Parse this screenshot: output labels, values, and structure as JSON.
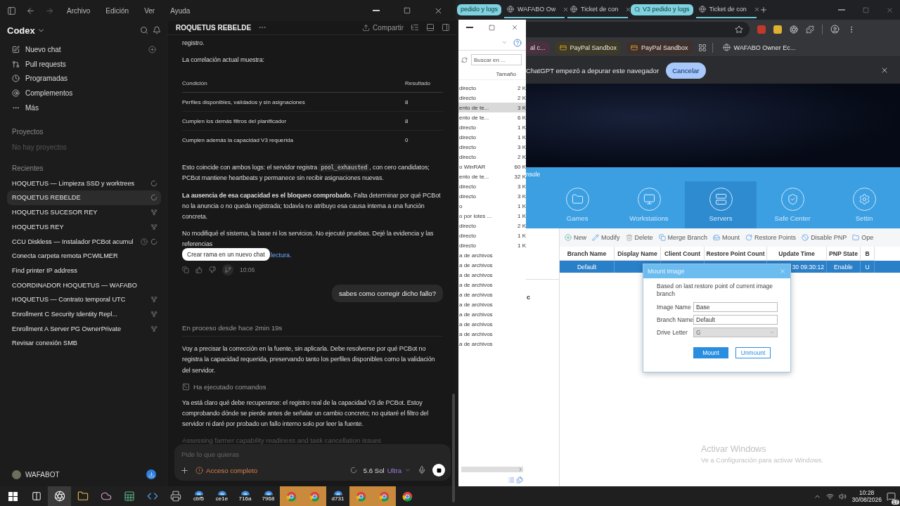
{
  "codex": {
    "menu": [
      "Archivo",
      "Edición",
      "Ver",
      "Ayuda"
    ],
    "app_name": "Codex",
    "nav": [
      {
        "kind": "new",
        "label": "Nuevo chat"
      },
      {
        "kind": "pulls",
        "label": "Pull requests"
      },
      {
        "kind": "scheduled",
        "label": "Programadas"
      },
      {
        "kind": "plugins",
        "label": "Complementos"
      },
      {
        "kind": "more",
        "label": "Más"
      }
    ],
    "projects_heading": "Proyectos",
    "projects_empty": "No hay proyectos",
    "recents_heading": "Recientes",
    "recents": [
      {
        "title": "HOQUETUS — Limpieza SSD y worktrees",
        "selected": false,
        "running": true,
        "forked": false,
        "scheduled": false
      },
      {
        "title": "ROQUETUS REBELDE",
        "selected": true,
        "running": true,
        "forked": false,
        "scheduled": false
      },
      {
        "title": "HOQUETUS SUCESOR REY",
        "selected": false,
        "running": false,
        "forked": true,
        "scheduled": false
      },
      {
        "title": "HOQUETUS REY",
        "selected": false,
        "running": false,
        "forked": true,
        "scheduled": false
      },
      {
        "title": "CCU Diskless — Instalador PCBot acumul",
        "selected": false,
        "running": true,
        "forked": false,
        "scheduled": true
      },
      {
        "title": "Conecta carpeta remota PCWILMER",
        "selected": false,
        "running": false,
        "forked": false,
        "scheduled": false
      },
      {
        "title": "Find printer IP address",
        "selected": false,
        "running": false,
        "forked": false,
        "scheduled": false
      },
      {
        "title": "COORDINADOR HOQUETUS — WAFABO",
        "selected": false,
        "running": false,
        "forked": false,
        "scheduled": false
      },
      {
        "title": "HOQUETUS — Contrato temporal UTC",
        "selected": false,
        "running": false,
        "forked": true,
        "scheduled": false
      },
      {
        "title": "Enrollment C Security Identity Repl...",
        "selected": false,
        "running": false,
        "forked": true,
        "scheduled": false
      },
      {
        "title": "Enrollment A Server PG OwnerPrivate",
        "selected": false,
        "running": false,
        "forked": true,
        "scheduled": false
      },
      {
        "title": "Revisar conexión SMB",
        "selected": false,
        "running": false,
        "forked": false,
        "scheduled": false
      }
    ],
    "user": "WAFABOT"
  },
  "chat": {
    "title": "ROQUETUS REBELDE",
    "share": "Compartir",
    "intro": "registro.",
    "table_lead": "La correlación actual muestra:",
    "table": {
      "columns": [
        "Condición",
        "Resultado"
      ],
      "rows": [
        [
          "Perfiles disponibles, validados y sin asignaciones",
          "8"
        ],
        [
          "Cumplen los demás filtros del planificador",
          "8"
        ],
        [
          "Cumplen además la capacidad V3 requerida",
          "0"
        ]
      ]
    },
    "evidence": {
      "before": "Esto coincide con ambos logs: el servidor registra ",
      "code": "pool_exhausted",
      "after": ", con cero candidatos; PCBot mantiene heartbeats y permanece sin recibir asignaciones nuevas."
    },
    "finding": "**La ausencia de esa capacidad es el bloqueo comprobado.** Falta determinar por qué PCBot no la anuncia o no queda registrada; todavía no atribuyo esa causa interna a una función concreta.",
    "closing": "No modifiqué el sistema, la base ni los servicios. No ejecuté pruebas. Dejé la evidencia y las referencias",
    "closing_link": "lectura.",
    "tooltip": "Crear rama en un nuevo chat",
    "time": "10:06",
    "user_message": "sabes como corregir dicho fallo?",
    "status": "En proceso desde hace 2min 19s",
    "reply": "Voy a precisar la corrección en la fuente, sin aplicarla. Debe resolverse por qué PCBot no registra la capacidad requerida, preservando tanto los perfiles disponibles como la validación del servidor.",
    "tool": "Ha ejecutado comandos",
    "reply2": "Ya está claro qué debe recuperarse: el registro real de la capacidad V3 de PCBot. Estoy comprobando dónde se pierde antes de señalar un cambio concreto; no quitaré el filtro del servidor ni daré por probado un fallo interno solo por leer la fuente.",
    "thinking": "Assessing farmer capability readiness and task cancellation issues",
    "composer": {
      "placeholder": "Pide lo que quieras",
      "access": "Acceso completo",
      "model": "5.6 Sol",
      "effort": "Ultra"
    }
  },
  "browser": {
    "tabs": [
      {
        "kind": "group",
        "label": "pedido y logs"
      },
      {
        "kind": "page",
        "label": "WAFABO Ow"
      },
      {
        "kind": "page",
        "label": "Ticket de con"
      },
      {
        "kind": "group",
        "label": "V3 pedido y logs"
      },
      {
        "kind": "page",
        "label": "Ticket de con"
      }
    ],
    "bookmarks": [
      {
        "kind": "folder",
        "label": "al c..."
      },
      {
        "kind": "card",
        "label": "PayPal Sandbox"
      },
      {
        "kind": "card",
        "label": "PayPal Sandbox"
      },
      {
        "kind": "apps"
      },
      {
        "kind": "site",
        "label": "WAFABO Owner Ec..."
      }
    ],
    "infobar": {
      "message": "ChatGPT empezó a depurar este navegador",
      "button": "Cancelar"
    }
  },
  "explorer": {
    "search_placeholder": "Buscar en ...",
    "column": "Tamaño",
    "files": [
      {
        "name": "directo",
        "size": "2 K",
        "selected": false
      },
      {
        "name": "directo",
        "size": "2 K",
        "selected": false
      },
      {
        "name": "ento de te...",
        "size": "3 K",
        "selected": true
      },
      {
        "name": "ento de te...",
        "size": "6 K",
        "selected": false
      },
      {
        "name": "directo",
        "size": "1 K",
        "selected": false
      },
      {
        "name": "directo",
        "size": "1 K",
        "selected": false
      },
      {
        "name": "directo",
        "size": "3 K",
        "selected": false
      },
      {
        "name": "directo",
        "size": "2 K",
        "selected": false
      },
      {
        "name": "o WinRAR",
        "size": "60 K",
        "selected": false
      },
      {
        "name": "ento de te...",
        "size": "32 K",
        "selected": false
      },
      {
        "name": "directo",
        "size": "3 K",
        "selected": false
      },
      {
        "name": "directo",
        "size": "3 K",
        "selected": false
      },
      {
        "name": "o",
        "size": "1 K",
        "selected": false
      },
      {
        "name": "o por lotes ...",
        "size": "1 K",
        "selected": false
      },
      {
        "name": "directo",
        "size": "2 K",
        "selected": false
      },
      {
        "name": "directo",
        "size": "1 K",
        "selected": false
      },
      {
        "name": "directo",
        "size": "1 K",
        "selected": false
      },
      {
        "name": "a de archivos",
        "selected": false
      },
      {
        "name": "a de archivos",
        "selected": false
      },
      {
        "name": "a de archivos",
        "selected": false
      },
      {
        "name": "a de archivos",
        "selected": false
      },
      {
        "name": "a de archivos",
        "selected": false
      },
      {
        "name": "a de archivos",
        "selected": false
      },
      {
        "name": "a de archivos",
        "selected": false
      },
      {
        "name": "a de archivos",
        "selected": false
      },
      {
        "name": "a de archivos",
        "selected": false
      },
      {
        "name": "a de archivos",
        "selected": false
      }
    ]
  },
  "console": {
    "title": "nsole",
    "nav": [
      {
        "kind": "folder",
        "label": "Games",
        "selected": false
      },
      {
        "kind": "monitor",
        "label": "Workstations",
        "selected": false
      },
      {
        "kind": "server",
        "label": "Servers",
        "selected": true
      },
      {
        "kind": "shield",
        "label": "Safe Center",
        "selected": false
      },
      {
        "kind": "gear",
        "label": "Settin",
        "selected": false
      }
    ],
    "toolbar": [
      {
        "kind": "add",
        "label": "New"
      },
      {
        "kind": "edit",
        "label": "Modify"
      },
      {
        "kind": "delete",
        "label": "Delete"
      },
      {
        "kind": "merge",
        "label": "Merge Branch"
      },
      {
        "kind": "mount",
        "label": "Mount"
      },
      {
        "kind": "restore",
        "label": "Restore Points"
      },
      {
        "kind": "disable",
        "label": "Disable PNP"
      },
      {
        "kind": "open",
        "label": "Ope"
      }
    ],
    "side_text": "c",
    "columns": [
      "Branch Name",
      "Display Name",
      "Client Count",
      "Restore Point Count",
      "Update Time",
      "PNP State",
      "B"
    ],
    "rows": [
      {
        "selected": true,
        "branch_name": "Default",
        "update_time": "30 09:30:12",
        "pnp_state": "Enable",
        "column_7": "U"
      }
    ],
    "dialog": {
      "title": "Mount Image",
      "description": "Based on last restore point of current image branch",
      "fields": [
        {
          "kind": "text",
          "label": "Image Name",
          "value": "Base",
          "disabled": false
        },
        {
          "kind": "text",
          "label": "Branch Name",
          "value": "Default",
          "disabled": false
        },
        {
          "kind": "select",
          "label": "Drive Letter",
          "value": "G",
          "disabled": true
        }
      ],
      "buttons": [
        {
          "label": "Mount",
          "primary": true
        },
        {
          "label": "Unmount",
          "primary": false
        }
      ]
    }
  },
  "activation": {
    "title": "Activar Windows",
    "subtitle": "Ve a Configuración para activar Windows."
  },
  "taskbar": {
    "apps": [
      {
        "kind": "start",
        "active": false,
        "flashing": false
      },
      {
        "kind": "task-view",
        "active": false,
        "flashing": false
      },
      {
        "kind": "aperture",
        "active": true,
        "flashing": false
      },
      {
        "kind": "folder",
        "active": false,
        "flashing": false
      },
      {
        "kind": "cloud",
        "active": false,
        "flashing": false
      },
      {
        "kind": "sheet",
        "active": false,
        "flashing": false
      },
      {
        "kind": "code",
        "active": false,
        "flashing": false
      },
      {
        "kind": "printer",
        "active": false,
        "flashing": false
      },
      {
        "kind": "badge",
        "label": "cbf5",
        "active": false,
        "flashing": false
      },
      {
        "kind": "badge",
        "label": "ce1e",
        "active": false,
        "flashing": false
      },
      {
        "kind": "badge",
        "label": "716a",
        "active": false,
        "flashing": false
      },
      {
        "kind": "badge",
        "label": "7968",
        "active": false,
        "flashing": false
      },
      {
        "kind": "browser",
        "active": false,
        "flashing": true
      },
      {
        "kind": "browser",
        "active": false,
        "flashing": true
      },
      {
        "kind": "badge",
        "label": "d731",
        "active": false,
        "flashing": false
      },
      {
        "kind": "browser",
        "active": false,
        "flashing": true
      },
      {
        "kind": "browser",
        "active": false,
        "flashing": true
      },
      {
        "kind": "browser",
        "active": false,
        "flashing": false
      }
    ],
    "time": "10:28",
    "date": "30/08/2026",
    "notifications": "17"
  }
}
